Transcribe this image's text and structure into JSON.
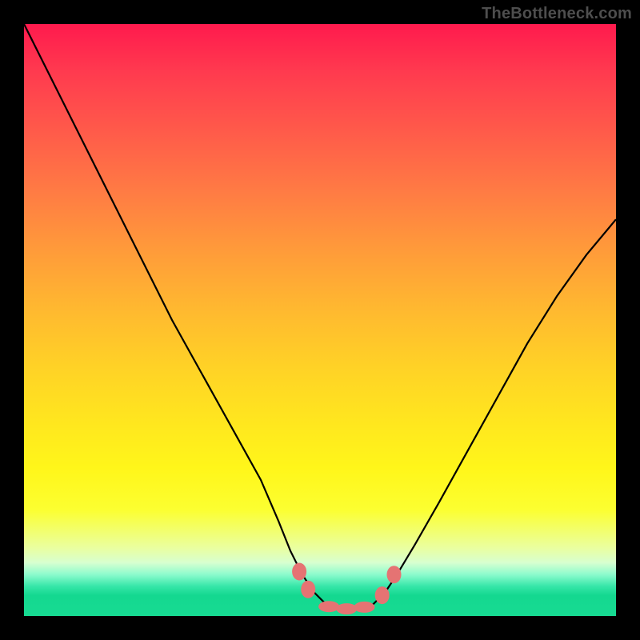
{
  "watermark": "TheBottleneck.com",
  "colors": {
    "frame": "#000000",
    "curve": "#000000",
    "marker": "#e57373"
  },
  "chart_data": {
    "type": "line",
    "title": "",
    "xlabel": "",
    "ylabel": "",
    "xlim": [
      0,
      100
    ],
    "ylim": [
      0,
      100
    ],
    "grid": false,
    "legend": false,
    "note": "Bottleneck-style V-curve over a vertical red→yellow→green gradient. Y axis is inverted visually (0 at bottom / 100 at top of the colored panel). Values are estimates read off the image; no axis ticks are rendered.",
    "series": [
      {
        "name": "bottleneck-curve",
        "x": [
          0,
          5,
          10,
          15,
          20,
          25,
          30,
          35,
          40,
          43,
          45,
          47,
          49,
          51,
          53,
          55,
          57,
          59,
          61,
          63,
          66,
          70,
          75,
          80,
          85,
          90,
          95,
          100
        ],
        "y": [
          100,
          90,
          80,
          70,
          60,
          50,
          41,
          32,
          23,
          16,
          11,
          7,
          4,
          2,
          1.3,
          1.2,
          1.3,
          2,
          4,
          7,
          12,
          19,
          28,
          37,
          46,
          54,
          61,
          67
        ]
      }
    ],
    "markers": {
      "name": "bottom-markers",
      "points": [
        {
          "x": 46.5,
          "y": 7.5
        },
        {
          "x": 48.0,
          "y": 4.5
        },
        {
          "x": 51.5,
          "y": 1.6
        },
        {
          "x": 54.5,
          "y": 1.2
        },
        {
          "x": 57.5,
          "y": 1.5
        },
        {
          "x": 60.5,
          "y": 3.5
        },
        {
          "x": 62.5,
          "y": 7.0
        }
      ]
    },
    "gradient_stops": [
      {
        "pos": 0,
        "color": "#ff1a4d"
      },
      {
        "pos": 0.5,
        "color": "#ffd226"
      },
      {
        "pos": 0.82,
        "color": "#fcff30"
      },
      {
        "pos": 1.0,
        "color": "#17db92"
      }
    ]
  }
}
